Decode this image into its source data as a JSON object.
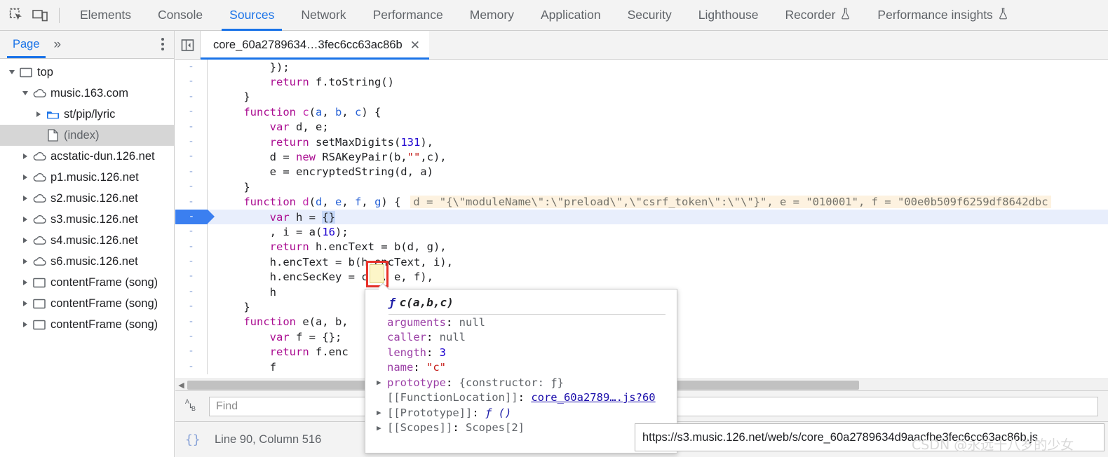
{
  "devtools": {
    "toolbar_icons": [
      {
        "name": "inspect-element-icon"
      },
      {
        "name": "device-toolbar-icon"
      }
    ],
    "tabs": [
      {
        "label": "Elements",
        "active": false,
        "experimental": false
      },
      {
        "label": "Console",
        "active": false,
        "experimental": false
      },
      {
        "label": "Sources",
        "active": true,
        "experimental": false
      },
      {
        "label": "Network",
        "active": false,
        "experimental": false
      },
      {
        "label": "Performance",
        "active": false,
        "experimental": false
      },
      {
        "label": "Memory",
        "active": false,
        "experimental": false
      },
      {
        "label": "Application",
        "active": false,
        "experimental": false
      },
      {
        "label": "Security",
        "active": false,
        "experimental": false
      },
      {
        "label": "Lighthouse",
        "active": false,
        "experimental": false
      },
      {
        "label": "Recorder",
        "active": false,
        "experimental": true
      },
      {
        "label": "Performance insights",
        "active": false,
        "experimental": true
      }
    ],
    "accent_color": "#1a73e8"
  },
  "navigator": {
    "tab_label": "Page",
    "more_label": "»",
    "menu_icon": "three-dots-icon",
    "tree": [
      {
        "label": "top",
        "icon": "frame-icon",
        "indent": 0,
        "caret": "open",
        "selected": false,
        "dim": false
      },
      {
        "label": "music.163.com",
        "icon": "cloud-icon",
        "indent": 1,
        "caret": "open",
        "selected": false,
        "dim": false
      },
      {
        "label": "st/pip/lyric",
        "icon": "folder-icon-blue",
        "indent": 2,
        "caret": "closed",
        "selected": false,
        "dim": false
      },
      {
        "label": "(index)",
        "icon": "document-icon",
        "indent": 2,
        "caret": "none",
        "selected": true,
        "dim": true
      },
      {
        "label": "acstatic-dun.126.net",
        "icon": "cloud-icon",
        "indent": 1,
        "caret": "closed",
        "selected": false,
        "dim": false
      },
      {
        "label": "p1.music.126.net",
        "icon": "cloud-icon",
        "indent": 1,
        "caret": "closed",
        "selected": false,
        "dim": false
      },
      {
        "label": "s2.music.126.net",
        "icon": "cloud-icon",
        "indent": 1,
        "caret": "closed",
        "selected": false,
        "dim": false
      },
      {
        "label": "s3.music.126.net",
        "icon": "cloud-icon",
        "indent": 1,
        "caret": "closed",
        "selected": false,
        "dim": false
      },
      {
        "label": "s4.music.126.net",
        "icon": "cloud-icon",
        "indent": 1,
        "caret": "closed",
        "selected": false,
        "dim": false
      },
      {
        "label": "s6.music.126.net",
        "icon": "cloud-icon",
        "indent": 1,
        "caret": "closed",
        "selected": false,
        "dim": false
      },
      {
        "label": "contentFrame (song)",
        "icon": "frame-icon",
        "indent": 1,
        "caret": "closed",
        "selected": false,
        "dim": false
      },
      {
        "label": "contentFrame (song)",
        "icon": "frame-icon",
        "indent": 1,
        "caret": "closed",
        "selected": false,
        "dim": false
      },
      {
        "label": "contentFrame (song)",
        "icon": "frame-icon",
        "indent": 1,
        "caret": "closed",
        "selected": false,
        "dim": false
      }
    ]
  },
  "editor": {
    "navigator_toggle_icon": "show-navigator-icon",
    "file_tab": {
      "label": "core_60a2789634…3fec6cc63ac86b",
      "close_label": "✕"
    },
    "gutter_marker": "-",
    "execution_line_index": 11,
    "inline_values": "d = \"{\\\"moduleName\\\":\\\"preload\\\",\\\"csrf_token\\\":\\\"\\\"}\", e = \"010001\", f = \"00e0b509f6259df8642dbc",
    "lines": [
      "        });",
      "        return f.toString()",
      "    }",
      "    function c(a, b, c) {",
      "        var d, e;",
      "        return setMaxDigits(131),",
      "        d = new RSAKeyPair(b,\"\",c),",
      "        e = encryptedString(d, a)",
      "    }",
      "    function d(d, e, f, g) {",
      "        var h = {}",
      "        , i = a(16);",
      "        return h.encText = b(d, g),",
      "        h.encText = b(h.encText, i),",
      "        h.encSecKey = c(i, e, f),",
      "        h",
      "    }",
      "    function e(a, b,",
      "        var f = {};",
      "        return f.enc",
      "        f"
    ],
    "find": {
      "icon": "replace-icon",
      "placeholder": "Find",
      "value": ""
    },
    "status": {
      "pretty_print_icon": "{}",
      "text": "Line 90, Column 516"
    }
  },
  "popover": {
    "title_fn_glyph": "ƒ",
    "title": "c(a,b,c)",
    "rows": [
      {
        "expandable": false,
        "key": "arguments",
        "sep": ": ",
        "value": "null",
        "value_type": "plain"
      },
      {
        "expandable": false,
        "key": "caller",
        "sep": ": ",
        "value": "null",
        "value_type": "plain"
      },
      {
        "expandable": false,
        "key": "length",
        "sep": ": ",
        "value": "3",
        "value_type": "number"
      },
      {
        "expandable": false,
        "key": "name",
        "sep": ": ",
        "value": "\"c\"",
        "value_type": "string"
      },
      {
        "expandable": true,
        "key": "prototype",
        "sep": ": ",
        "value": "{constructor: ƒ}",
        "value_type": "plain"
      },
      {
        "expandable": false,
        "key": "[[FunctionLocation]]",
        "sep": ": ",
        "value": "core_60a2789….js?60",
        "value_type": "link"
      },
      {
        "expandable": true,
        "key": "[[Prototype]]",
        "sep": ": ",
        "value": "ƒ ()",
        "value_type": "fn"
      },
      {
        "expandable": true,
        "key": "[[Scopes]]",
        "sep": ": ",
        "value": "Scopes[2]",
        "value_type": "plain"
      }
    ]
  },
  "url_tooltip": {
    "text": "https://s3.music.126.net/web/s/core_60a2789634d9aacfbe3fec6cc63ac86b.js"
  },
  "watermark": {
    "text": "CSDN @永远十八岁的少女"
  },
  "annotations": {
    "highlight_token": "c",
    "box_color": "#e8322a",
    "highlight_color": "#fdf6c8"
  }
}
